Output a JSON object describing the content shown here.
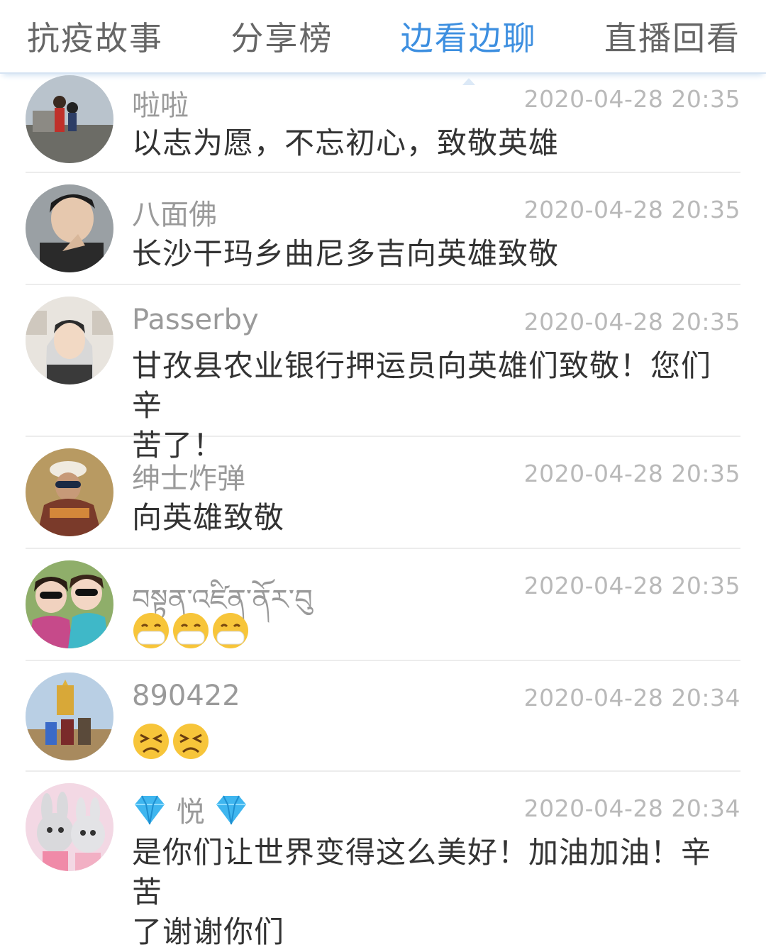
{
  "tabs": [
    "抗疫故事",
    "分享榜",
    "边看边聊",
    "直播回看"
  ],
  "active_tab_index": 2,
  "colors": {
    "accent": "#3d8fe0",
    "name": "#9a9a9a",
    "time": "#b9b9b9",
    "text": "#333333"
  },
  "comments": [
    {
      "name": "啦啦",
      "time": "2020-04-28 20:35",
      "text": "以志为愿，不忘初心，致敬英雄"
    },
    {
      "name": "八面佛",
      "time": "2020-04-28 20:35",
      "text": "长沙干玛乡曲尼多吉向英雄致敬"
    },
    {
      "name": "Passerby",
      "time": "2020-04-28 20:35",
      "text_line1": "甘孜县农业银行押运员向英雄们致敬！您们辛",
      "text_line2": "苦了！"
    },
    {
      "name": "绅士炸弹",
      "time": "2020-04-28 20:35",
      "text": "向英雄致敬"
    },
    {
      "name": "བསྟན་འཛིན་ནོར་བུ",
      "time": "2020-04-28 20:35",
      "emojis": [
        "mask-emoji",
        "mask-emoji",
        "mask-emoji"
      ]
    },
    {
      "name": "890422",
      "time": "2020-04-28 20:34",
      "emojis": [
        "tired-face-emoji",
        "tired-face-emoji"
      ]
    },
    {
      "name": "悦",
      "name_icons": [
        "diamond-icon",
        "diamond-icon"
      ],
      "time": "2020-04-28 20:34",
      "text_line1": "是你们让世界变得这么美好！加油加油！辛苦",
      "text_line2": "了谢谢你们"
    }
  ]
}
